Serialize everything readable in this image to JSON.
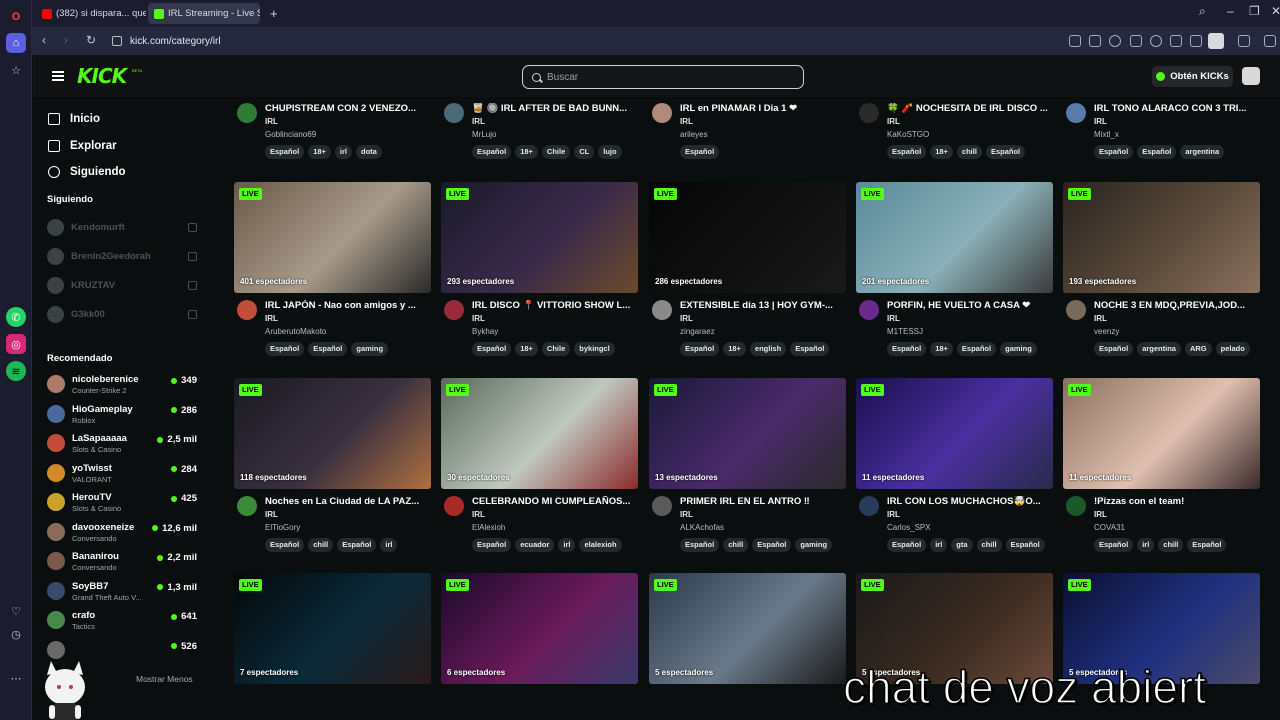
{
  "browser": {
    "tabs": [
      {
        "label": "(382) si dispara... que?! (n...",
        "fav_color": "#ff0000",
        "active": false
      },
      {
        "label": "IRL Streaming - Live Stream",
        "fav_color": "#53fc18",
        "active": true
      }
    ],
    "new_tab": "+",
    "url": "kick.com/category/irl",
    "window_controls": [
      "–",
      "❐",
      "✕"
    ]
  },
  "header": {
    "logo": "KICK",
    "logo_beta": "BETA",
    "search_placeholder": "Buscar",
    "kicks_button": "Obtén KICKs"
  },
  "sidebar": {
    "nav": [
      {
        "label": "Inicio",
        "icon": "home-icon"
      },
      {
        "label": "Explorar",
        "icon": "compass-icon"
      },
      {
        "label": "Siguiendo",
        "icon": "heart-icon"
      }
    ],
    "following_heading": "Siguiendo",
    "following": [
      "Kendomurft",
      "Brenin2Geedorah",
      "KRUZTAV",
      "G3kk00"
    ],
    "recommended_heading": "Recomendado",
    "recommended": [
      {
        "name": "nicoleberenice",
        "category": "Counter-Strike 2",
        "viewers": "349",
        "color": "#b07a6a"
      },
      {
        "name": "HioGameplay",
        "category": "Roblox",
        "viewers": "286",
        "color": "#4a6a9a"
      },
      {
        "name": "LaSapaaaaa",
        "category": "Slots & Casino",
        "viewers": "2,5 mil",
        "color": "#c24d3a"
      },
      {
        "name": "yoTwisst",
        "category": "VALORANT",
        "viewers": "284",
        "color": "#d08a2a"
      },
      {
        "name": "HerouTV",
        "category": "Slots & Casino",
        "viewers": "425",
        "color": "#c9a22a"
      },
      {
        "name": "davooxeneize",
        "category": "Conversando",
        "viewers": "12,6 mil",
        "color": "#8a6a5a"
      },
      {
        "name": "Bananirou",
        "category": "Conversando",
        "viewers": "2,2 mil",
        "color": "#7a5a4a"
      },
      {
        "name": "SoyBB7",
        "category": "Grand Theft Auto V...",
        "viewers": "1,3 mil",
        "color": "#3a4a6a"
      },
      {
        "name": "crafo",
        "category": "Tactics",
        "viewers": "641",
        "color": "#4a8a4a"
      },
      {
        "name": "",
        "category": "",
        "viewers": "526",
        "color": "#6a6a6a"
      }
    ],
    "show_less": "Mostrar Menos"
  },
  "cards_top": [
    {
      "title": "CHUPISTREAM CON 2 VENEZO...",
      "category": "IRL",
      "user": "Goblinciano69",
      "tags": [
        "Español",
        "18+",
        "irl",
        "dota"
      ],
      "avatar": "#2e7d32"
    },
    {
      "title": "🥃 🔘 IRL AFTER DE BAD BUNN...",
      "category": "IRL",
      "user": "MrLujo",
      "tags": [
        "Español",
        "18+",
        "Chile",
        "CL",
        "lujo"
      ],
      "avatar": "#4a6a7a"
    },
    {
      "title": "IRL en PINAMAR I Dia 1 ❤",
      "category": "IRL",
      "user": "arileyes",
      "tags": [
        "Español"
      ],
      "avatar": "#b08a7a"
    },
    {
      "title": "🍀 🧨 NOCHESITA DE IRL DISCO ...",
      "category": "IRL",
      "user": "KaKoSTGO",
      "tags": [
        "Español",
        "18+",
        "chill",
        "Español"
      ],
      "avatar": "#2a2a2a"
    },
    {
      "title": "IRL TONO ALARACO CON 3 TRI...",
      "category": "IRL",
      "user": "Mixtl_x",
      "tags": [
        "Español",
        "Español",
        "argentina"
      ],
      "avatar": "#5a7aaa"
    }
  ],
  "cards": [
    {
      "title": "IRL JAPÓN - Nao con amigos y ...",
      "category": "IRL",
      "user": "AruberutoMakoto",
      "viewers": "401 espectadores",
      "tags": [
        "Español",
        "Español",
        "gaming"
      ],
      "avatar": "#c24d3a",
      "thumb": [
        "#6a5a4a",
        "#a89a8a",
        "#2a2a2a"
      ],
      "live": "LIVE"
    },
    {
      "title": "IRL DISCO 📍 VITTORIO SHOW L...",
      "category": "IRL",
      "user": "Bykhay",
      "viewers": "293 espectadores",
      "tags": [
        "Español",
        "18+",
        "Chile",
        "bykingcl"
      ],
      "avatar": "#9a2a3a",
      "thumb": [
        "#1a1a2a",
        "#3a2a4a",
        "#6a4a2a"
      ],
      "live": "LIVE"
    },
    {
      "title": "EXTENSIBLE día 13 | HOY GYM-...",
      "category": "IRL",
      "user": "zingaraez",
      "viewers": "286 espectadores",
      "tags": [
        "Español",
        "18+",
        "english",
        "Español"
      ],
      "avatar": "#8a8a8a",
      "thumb": [
        "#050505",
        "#101010",
        "#1a1a1a"
      ],
      "live": "LIVE"
    },
    {
      "title": "PORFIN, HE VUELTO A CASA ❤",
      "category": "IRL",
      "user": "M1TESSJ",
      "viewers": "201 espectadores",
      "tags": [
        "Español",
        "18+",
        "Español",
        "gaming"
      ],
      "avatar": "#6a2a8a",
      "thumb": [
        "#5a8a9a",
        "#8ab0b8",
        "#3a3a3a"
      ],
      "live": "LIVE"
    },
    {
      "title": "NOCHE 3 EN MDQ,PREVIA,JOD...",
      "category": "IRL",
      "user": "veenzy",
      "viewers": "193 espectadores",
      "tags": [
        "Español",
        "argentina",
        "ARG",
        "pelado"
      ],
      "avatar": "#7a6a5a",
      "thumb": [
        "#2a2420",
        "#5a4a3a",
        "#8a7060"
      ],
      "live": "LIVE"
    },
    {
      "title": "Noches en La Ciudad de LA PAZ...",
      "category": "IRL",
      "user": "ElTioGory",
      "viewers": "118 espectadores",
      "tags": [
        "Español",
        "chill",
        "Español",
        "irl"
      ],
      "avatar": "#3a8a3a",
      "thumb": [
        "#1a1a22",
        "#3a3040",
        "#b07040"
      ],
      "live": "LIVE"
    },
    {
      "title": "CELEBRANDO MI CUMPLEAÑOS...",
      "category": "IRL",
      "user": "ElAlexioh",
      "viewers": "30 espectadores",
      "tags": [
        "Español",
        "ecuador",
        "irl",
        "elalexioh"
      ],
      "avatar": "#aa2a2a",
      "thumb": [
        "#5a6a5a",
        "#c0c8c0",
        "#8a2a2a"
      ],
      "live": "LIVE"
    },
    {
      "title": "PRIMER IRL EN EL ANTRO ‼",
      "category": "IRL",
      "user": "ALKAchofas",
      "viewers": "13 espectadores",
      "tags": [
        "Español",
        "chill",
        "Español",
        "gaming"
      ],
      "avatar": "#5a5a5a",
      "thumb": [
        "#1a1a3a",
        "#4a2a6a",
        "#2a2a2a"
      ],
      "live": "LIVE"
    },
    {
      "title": "IRL CON LOS MUCHACHOS🤯O...",
      "category": "IRL",
      "user": "Carlos_SPX",
      "viewers": "11 espectadores",
      "tags": [
        "Español",
        "irl",
        "gta",
        "chill",
        "Español"
      ],
      "avatar": "#2a3a5a",
      "thumb": [
        "#1a1050",
        "#4a30a0",
        "#2a2a4a"
      ],
      "live": "LIVE"
    },
    {
      "title": "!Pizzas con el team!",
      "category": "IRL",
      "user": "COVA31",
      "viewers": "11 espectadores",
      "tags": [
        "Español",
        "irl",
        "chill",
        "Español"
      ],
      "avatar": "#1a5a2a",
      "thumb": [
        "#8a7060",
        "#e0c0b0",
        "#3a2a2a"
      ],
      "live": "LIVE"
    },
    {
      "title": "",
      "category": "",
      "user": "",
      "viewers": "7 espectadores",
      "tags": [],
      "avatar": "#333",
      "thumb": [
        "#05080a",
        "#0a2a3a",
        "#2a1a1a"
      ],
      "live": "LIVE"
    },
    {
      "title": "",
      "category": "",
      "user": "",
      "viewers": "6 espectadores",
      "tags": [],
      "avatar": "#333",
      "thumb": [
        "#1a0a2a",
        "#6a1a5a",
        "#3a3a6a"
      ],
      "live": "LIVE"
    },
    {
      "title": "",
      "category": "",
      "user": "",
      "viewers": "5 espectadores",
      "tags": [],
      "avatar": "#333",
      "thumb": [
        "#2a3a4a",
        "#6a7a8a",
        "#1a1a1a"
      ],
      "live": "LIVE"
    },
    {
      "title": "",
      "category": "",
      "user": "",
      "viewers": "5 espectadores",
      "tags": [],
      "avatar": "#333",
      "thumb": [
        "#1a1a1a",
        "#3a2a20",
        "#6a4a3a"
      ],
      "live": "LIVE"
    },
    {
      "title": "",
      "category": "",
      "user": "",
      "viewers": "5 espectadores",
      "tags": [],
      "avatar": "#333",
      "thumb": [
        "#0a1030",
        "#203080",
        "#4a4a6a"
      ],
      "live": "LIVE"
    }
  ],
  "overlay_text": "chat de voz abiert"
}
